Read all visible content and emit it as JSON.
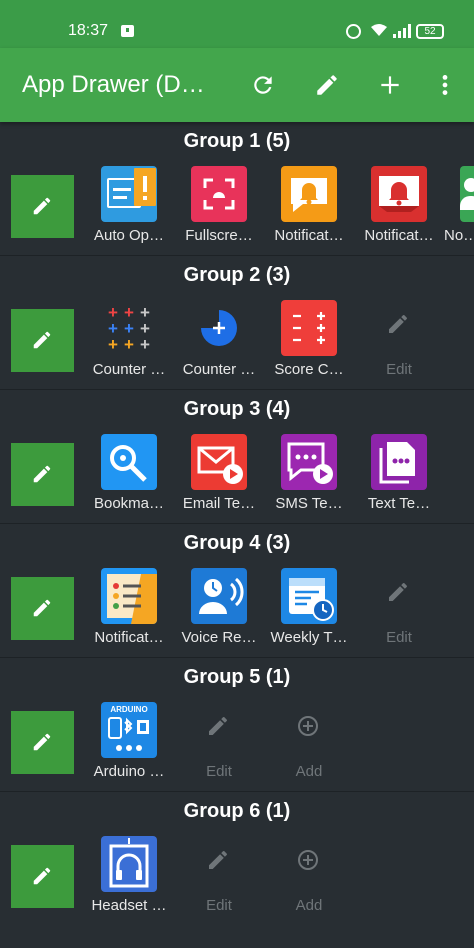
{
  "status": {
    "time": "18:37",
    "battery": "52"
  },
  "toolbar": {
    "title": "App Drawer (D…"
  },
  "groups": [
    {
      "title": "Group 1 (5)",
      "apps": [
        {
          "label": "Auto Op…"
        },
        {
          "label": "Fullscre…"
        },
        {
          "label": "Notificat…"
        },
        {
          "label": "Notificat…"
        },
        {
          "label": "No…"
        }
      ]
    },
    {
      "title": "Group 2 (3)",
      "apps": [
        {
          "label": "Counter …"
        },
        {
          "label": "Counter …"
        },
        {
          "label": "Score C…"
        },
        {
          "label": "Edit"
        }
      ]
    },
    {
      "title": "Group 3 (4)",
      "apps": [
        {
          "label": "Bookma…"
        },
        {
          "label": "Email Te…"
        },
        {
          "label": "SMS Te…"
        },
        {
          "label": "Text Te…"
        }
      ]
    },
    {
      "title": "Group 4 (3)",
      "apps": [
        {
          "label": "Notificat…"
        },
        {
          "label": "Voice Re…"
        },
        {
          "label": "Weekly T…"
        },
        {
          "label": "Edit"
        }
      ]
    },
    {
      "title": "Group 5 (1)",
      "apps": [
        {
          "label": "Arduino …",
          "badge": "ARDUINO"
        },
        {
          "label": "Edit"
        },
        {
          "label": "Add"
        }
      ]
    },
    {
      "title": "Group 6 (1)",
      "apps": [
        {
          "label": "Headset …"
        },
        {
          "label": "Edit"
        },
        {
          "label": "Add"
        }
      ]
    }
  ]
}
